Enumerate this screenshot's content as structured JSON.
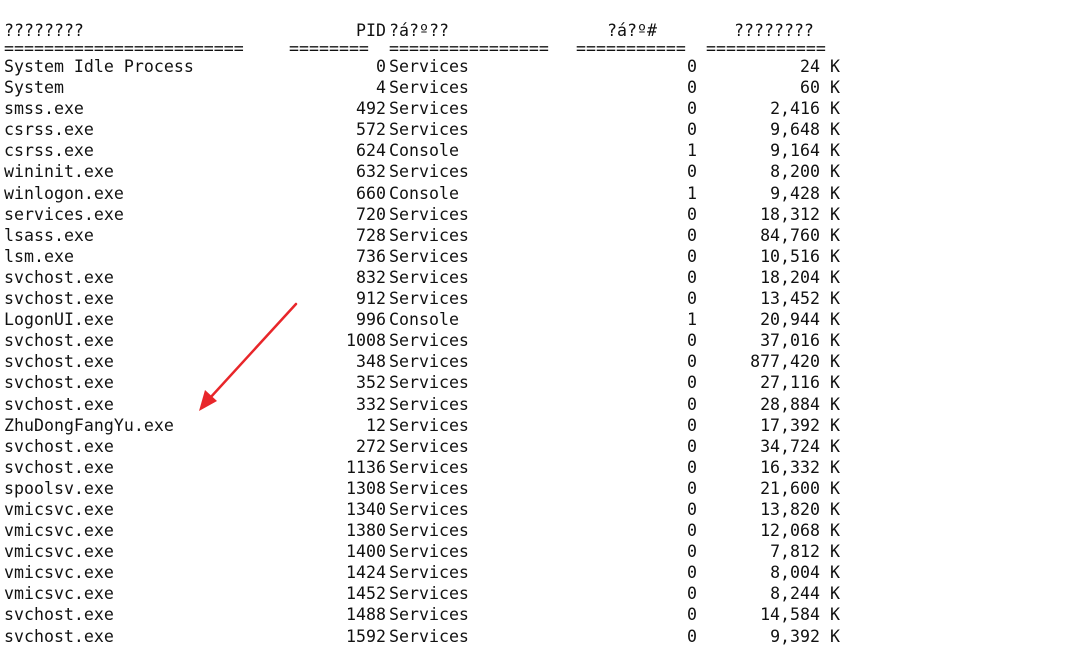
{
  "columns": {
    "name": "????????",
    "pid": "PID",
    "session": "?á?º??",
    "session_num": "?á?º#",
    "mem": "????????"
  },
  "separators": {
    "name": "========================",
    "pid": "========",
    "session": "================",
    "session_num": "===========",
    "mem": "============"
  },
  "rows": [
    {
      "name": "System Idle Process",
      "pid": "0",
      "session": "Services",
      "num": "0",
      "mem": "24 K"
    },
    {
      "name": "System",
      "pid": "4",
      "session": "Services",
      "num": "0",
      "mem": "60 K"
    },
    {
      "name": "smss.exe",
      "pid": "492",
      "session": "Services",
      "num": "0",
      "mem": "2,416 K"
    },
    {
      "name": "csrss.exe",
      "pid": "572",
      "session": "Services",
      "num": "0",
      "mem": "9,648 K"
    },
    {
      "name": "csrss.exe",
      "pid": "624",
      "session": "Console",
      "num": "1",
      "mem": "9,164 K"
    },
    {
      "name": "wininit.exe",
      "pid": "632",
      "session": "Services",
      "num": "0",
      "mem": "8,200 K"
    },
    {
      "name": "winlogon.exe",
      "pid": "660",
      "session": "Console",
      "num": "1",
      "mem": "9,428 K"
    },
    {
      "name": "services.exe",
      "pid": "720",
      "session": "Services",
      "num": "0",
      "mem": "18,312 K"
    },
    {
      "name": "lsass.exe",
      "pid": "728",
      "session": "Services",
      "num": "0",
      "mem": "84,760 K"
    },
    {
      "name": "lsm.exe",
      "pid": "736",
      "session": "Services",
      "num": "0",
      "mem": "10,516 K"
    },
    {
      "name": "svchost.exe",
      "pid": "832",
      "session": "Services",
      "num": "0",
      "mem": "18,204 K"
    },
    {
      "name": "svchost.exe",
      "pid": "912",
      "session": "Services",
      "num": "0",
      "mem": "13,452 K"
    },
    {
      "name": "LogonUI.exe",
      "pid": "996",
      "session": "Console",
      "num": "1",
      "mem": "20,944 K"
    },
    {
      "name": "svchost.exe",
      "pid": "1008",
      "session": "Services",
      "num": "0",
      "mem": "37,016 K"
    },
    {
      "name": "svchost.exe",
      "pid": "348",
      "session": "Services",
      "num": "0",
      "mem": "877,420 K"
    },
    {
      "name": "svchost.exe",
      "pid": "352",
      "session": "Services",
      "num": "0",
      "mem": "27,116 K"
    },
    {
      "name": "svchost.exe",
      "pid": "332",
      "session": "Services",
      "num": "0",
      "mem": "28,884 K"
    },
    {
      "name": "ZhuDongFangYu.exe",
      "pid": "12",
      "session": "Services",
      "num": "0",
      "mem": "17,392 K"
    },
    {
      "name": "svchost.exe",
      "pid": "272",
      "session": "Services",
      "num": "0",
      "mem": "34,724 K"
    },
    {
      "name": "svchost.exe",
      "pid": "1136",
      "session": "Services",
      "num": "0",
      "mem": "16,332 K"
    },
    {
      "name": "spoolsv.exe",
      "pid": "1308",
      "session": "Services",
      "num": "0",
      "mem": "21,600 K"
    },
    {
      "name": "vmicsvc.exe",
      "pid": "1340",
      "session": "Services",
      "num": "0",
      "mem": "13,820 K"
    },
    {
      "name": "vmicsvc.exe",
      "pid": "1380",
      "session": "Services",
      "num": "0",
      "mem": "12,068 K"
    },
    {
      "name": "vmicsvc.exe",
      "pid": "1400",
      "session": "Services",
      "num": "0",
      "mem": "7,812 K"
    },
    {
      "name": "vmicsvc.exe",
      "pid": "1424",
      "session": "Services",
      "num": "0",
      "mem": "8,004 K"
    },
    {
      "name": "vmicsvc.exe",
      "pid": "1452",
      "session": "Services",
      "num": "0",
      "mem": "8,244 K"
    },
    {
      "name": "svchost.exe",
      "pid": "1488",
      "session": "Services",
      "num": "0",
      "mem": "14,584 K"
    },
    {
      "name": "svchost.exe",
      "pid": "1592",
      "session": "Services",
      "num": "0",
      "mem": "9,392 K"
    }
  ],
  "annotation": {
    "arrow_icon": "red-arrow-icon",
    "arrow_color": "#e8262a",
    "points_to": "ZhuDongFangYu.exe"
  }
}
